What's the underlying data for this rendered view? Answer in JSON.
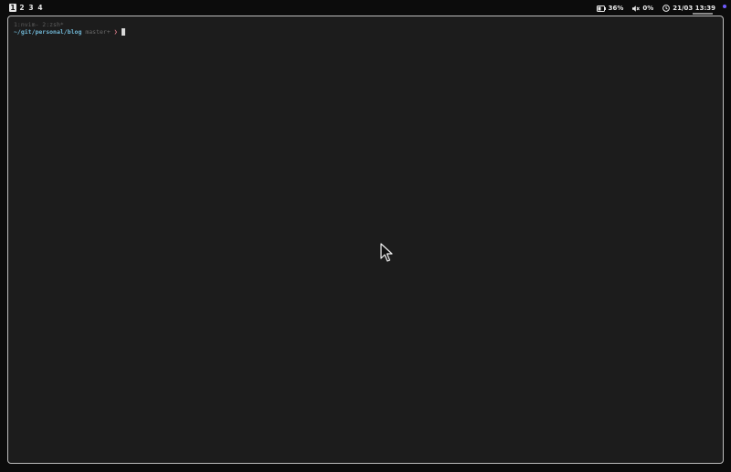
{
  "workspaces": [
    "1",
    "2",
    "3",
    "4"
  ],
  "active_workspace": "1",
  "status": {
    "battery": "36%",
    "volume": "0%",
    "datetime": "21/03 13:39"
  },
  "terminal": {
    "tabs": "1:nvim- 2:zsh*",
    "path": "~/git/personal/blog",
    "branch": "master+",
    "prompt_symbol": "❯"
  },
  "colors": {
    "path": "#6fb5d3",
    "prompt_symbol": "#d77a87",
    "status_dot": "#6f5cff"
  }
}
